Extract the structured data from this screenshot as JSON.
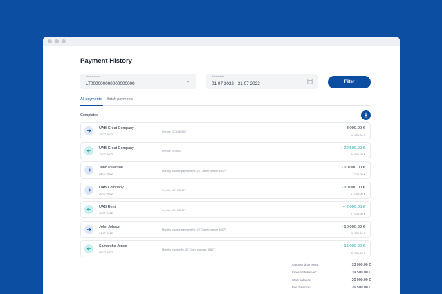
{
  "page": {
    "title": "Payment History",
    "account": {
      "label": "Your account",
      "value": "LT000000000000000000"
    },
    "date_range": {
      "label": "Select date",
      "value": "01 07 2022 - 31 07 2022"
    },
    "filter_label": "Filter",
    "tabs": [
      {
        "label": "All payments",
        "active": true
      },
      {
        "label": "Batch  payments",
        "active": false
      }
    ],
    "section_label": "Completed",
    "icons": {
      "download": "download-icon",
      "calendar": "calendar-icon",
      "chevron": "chevron-down-icon",
      "outgoing": "arrow-right-icon",
      "incoming": "arrow-left-icon"
    },
    "colors": {
      "brand": "#0b4ea2",
      "incoming_bg": "#cdeeee",
      "outgoing_bg": "#dfe6f7",
      "positive": "#1aa6a0"
    }
  },
  "payments": [
    {
      "direction": "out",
      "name": "UAB Great Company",
      "date": "29 07 2022",
      "description": "Invoice GCA56-542",
      "amount": "- 3 000.00 €",
      "balance": "26 500.00 €"
    },
    {
      "direction": "in",
      "name": "UAB Great Company",
      "date": "27 07 2022",
      "description": "Invoice GR-657",
      "amount": "+ 22 500.00 €",
      "balance": "29 500.00 €"
    },
    {
      "direction": "out",
      "name": "John Peterson",
      "date": "24 07 2022",
      "description": "Monthy invoice payment Nr. 22 Client number 45677",
      "amount": "- 10 000.00 €",
      "balance": "7 000.00 €"
    },
    {
      "direction": "out",
      "name": "UAB Company",
      "date": "20 07 2022",
      "description": "Invoice NR. 34567",
      "amount": "- 10 000.00 €",
      "balance": "17 000.00 €"
    },
    {
      "direction": "in",
      "name": "UAB Rent",
      "date": "18 07 2022",
      "description": "Invoice NR. 34567",
      "amount": "+ 2 000.00 €",
      "balance": "27 000.00 €"
    },
    {
      "direction": "out",
      "name": "John Johson",
      "date": "14 07 2022",
      "description": "Monthy invoice payment Nr. 22 Client number 45677",
      "amount": "- 10 000.00 €",
      "balance": "25 000.00 €"
    },
    {
      "direction": "in",
      "name": "Samantha Jones",
      "date": "05 07 2022",
      "description": "Monthy invoice Nr. 22 Client number 45677",
      "amount": "+ 15 000.00 €",
      "balance": "35 000.00 €"
    }
  ],
  "summary": [
    {
      "label": "Outbound turnover:",
      "value": "33 000.00 €"
    },
    {
      "label": "Inbound turnover:",
      "value": "39 500.00 €"
    },
    {
      "label": "Start balance:",
      "value": "20 000.00 €"
    },
    {
      "label": "End balance:",
      "value": "26 500.00 €"
    }
  ]
}
